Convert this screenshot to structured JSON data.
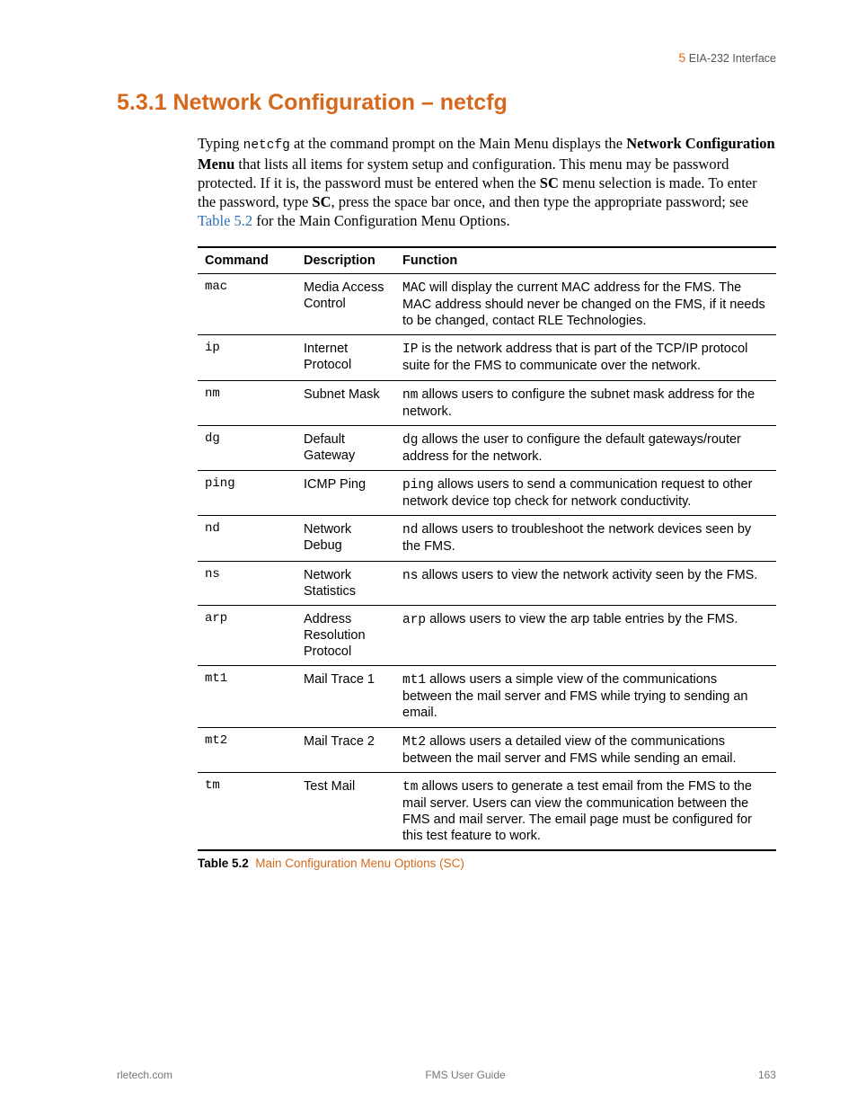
{
  "header": {
    "chapter_number": "5",
    "chapter_title": "EIA-232 Interface"
  },
  "section": {
    "heading": "5.3.1 Network Configuration – netcfg",
    "intro_pre": "Typing ",
    "intro_code": "netcfg",
    "intro_mid1": " at the command prompt on the Main Menu displays the ",
    "intro_bold1": "Network Configuration Menu",
    "intro_mid2": " that lists all items for system setup and configuration. This menu may be password protected. If it is, the password must be entered when the ",
    "intro_bold2": "SC",
    "intro_mid3": " menu selection is made. To enter the password, type ",
    "intro_bold3": "SC",
    "intro_mid4": ", press the space bar once, and then type the appropriate password; see ",
    "intro_link": "Table 5.2",
    "intro_end": " for the Main Configuration Menu Options."
  },
  "table": {
    "headers": {
      "col1": "Command",
      "col2": "Description",
      "col3": "Function"
    },
    "rows": [
      {
        "command": "mac",
        "description": "Media Access Control",
        "func_code": "MAC",
        "func_text": " will display the current MAC address for the FMS. The MAC address should never be changed on the FMS, if it needs to be changed, contact RLE Technologies."
      },
      {
        "command": "ip",
        "description": "Internet Protocol",
        "func_code": "IP",
        "func_text": " is the network address that is part of the TCP/IP protocol suite for the FMS to communicate over the network."
      },
      {
        "command": "nm",
        "description": "Subnet Mask",
        "func_code": "nm",
        "func_text": " allows users to configure the subnet mask address for the network."
      },
      {
        "command": "dg",
        "description": "Default Gateway",
        "func_code": "dg",
        "func_text": " allows the user to configure the default gateways/router address for the network."
      },
      {
        "command": "ping",
        "description": "ICMP Ping",
        "func_code": "ping",
        "func_text": " allows users to send a communication request to other network device top check for network conductivity."
      },
      {
        "command": "nd",
        "description": "Network Debug",
        "func_code": "nd",
        "func_text": " allows users to troubleshoot the network devices seen by the FMS."
      },
      {
        "command": "ns",
        "description": "Network Statistics",
        "func_code": "ns",
        "func_text": " allows users to view the network activity seen by the FMS."
      },
      {
        "command": "arp",
        "description": "Address Resolution Protocol",
        "func_code": "arp",
        "func_text": " allows users to view the arp table entries by the FMS."
      },
      {
        "command": "mt1",
        "description": "Mail Trace 1",
        "func_code": "mt1",
        "func_text": " allows users a simple view of the communications between the mail server and FMS while trying to sending an email."
      },
      {
        "command": "mt2",
        "description": "Mail Trace 2",
        "func_code": "Mt2",
        "func_text": " allows users a detailed view of the communications between the mail server and FMS while sending an email."
      },
      {
        "command": "tm",
        "description": "Test Mail",
        "func_code": "tm",
        "func_text": " allows users to generate a test email from the FMS to the mail server. Users can view the communication between the FMS and mail server. The email page must be configured for this test feature to work."
      }
    ],
    "caption_label": "Table 5.2",
    "caption_text": "Main Configuration Menu Options (SC)"
  },
  "footer": {
    "left": "rletech.com",
    "center": "FMS User Guide",
    "right": "163"
  }
}
